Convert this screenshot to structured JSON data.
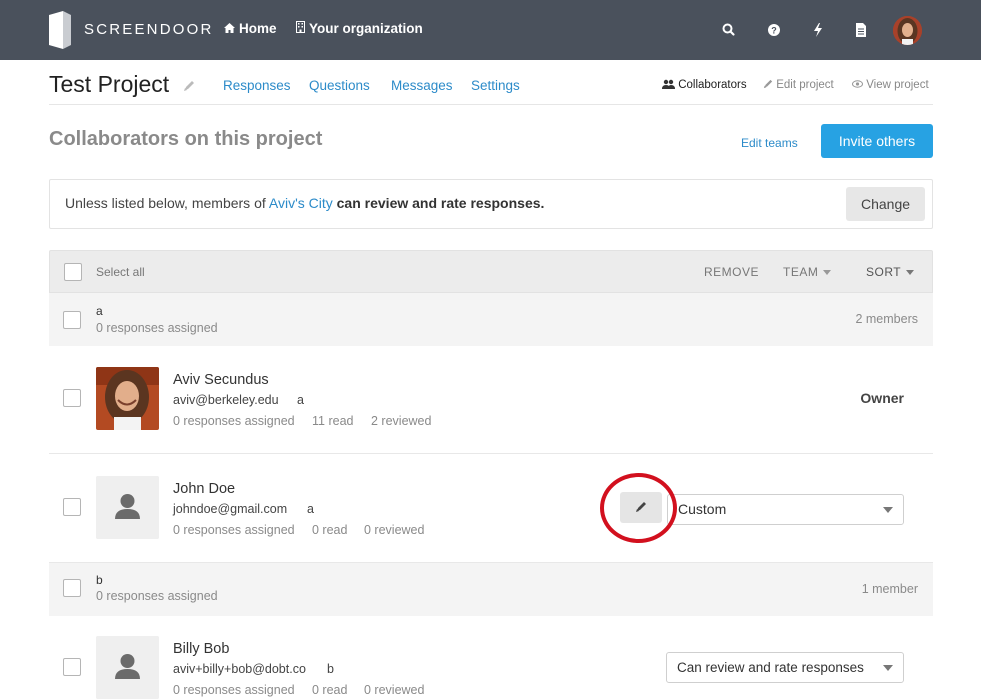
{
  "topnav": {
    "brand": "SCREENDOOR",
    "home_label": "Home",
    "org_label": "Your organization",
    "icons": [
      "search-icon",
      "help-icon",
      "bolt-icon",
      "document-icon",
      "user-avatar"
    ]
  },
  "project": {
    "title": "Test Project",
    "tabs": [
      "Responses",
      "Questions",
      "Messages",
      "Settings"
    ],
    "right_links": [
      "Collaborators",
      "Edit project",
      "View project"
    ]
  },
  "section": {
    "title": "Collaborators on this project",
    "edit_teams": "Edit teams",
    "invite_button": "Invite others"
  },
  "notice": {
    "prefix": "Unless listed below, members of ",
    "org_link": "Aviv's City",
    "suffix": " can review and rate responses.",
    "change_button": "Change"
  },
  "table": {
    "select_all": "Select all",
    "remove": "REMOVE",
    "team": "TEAM",
    "sort": "SORT"
  },
  "groups": [
    {
      "name": "a",
      "assigned": "0 responses assigned",
      "count": "2 members"
    },
    {
      "name": "b",
      "assigned": "0 responses assigned",
      "count": "1 member"
    }
  ],
  "members": [
    {
      "name": "Aviv Secundus",
      "email": "aviv@berkeley.edu",
      "team": "a",
      "assigned": "0 responses assigned",
      "read": "11 read",
      "reviewed": "2 reviewed",
      "role": "Owner"
    },
    {
      "name": "John Doe",
      "email": "johndoe@gmail.com",
      "team": "a",
      "assigned": "0 responses assigned",
      "read": "0 read",
      "reviewed": "0 reviewed",
      "role": "Custom"
    },
    {
      "name": "Billy Bob",
      "email": "aviv+billy+bob@dobt.co",
      "team": "b",
      "assigned": "0 responses assigned",
      "read": "0 read",
      "reviewed": "0 reviewed",
      "role": "Can review and rate responses"
    }
  ],
  "colors": {
    "nav_bg": "#4a515c",
    "link": "#2c8bc9",
    "primary_button": "#27a2e3",
    "annotation_circle": "#d2101e"
  }
}
